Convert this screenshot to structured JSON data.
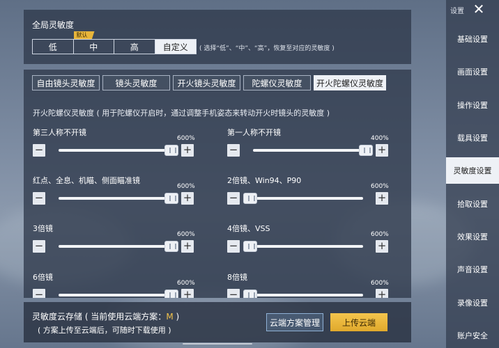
{
  "global": {
    "title": "全局灵敏度",
    "badge": "默认",
    "options": [
      "低",
      "中",
      "高",
      "自定义"
    ],
    "hint": "( 选择“低”、“中”、“高”，恢复至对应的灵敏度 )"
  },
  "tabs": [
    "自由镜头灵敏度",
    "镜头灵敏度",
    "开火镜头灵敏度",
    "陀螺仪灵敏度",
    "开火陀螺仪灵敏度"
  ],
  "section": {
    "description": "开火陀螺仪灵敏度 ( 用于陀螺仪开启时，通过调整手机姿态来转动开火时镜头的灵敏度 )"
  },
  "sliders": [
    {
      "label": "第三人称不开镜",
      "value_label": "600%",
      "value": 1.0
    },
    {
      "label": "第一人称不开镜",
      "value_label": "400%",
      "value": 1.0
    },
    {
      "label": "红点、全息、机瞄、侧面瞄准镜",
      "value_label": "600%",
      "value": 1.0
    },
    {
      "label": "2倍镜、Win94、P90",
      "value_label": "600%",
      "value": 0.0
    },
    {
      "label": "3倍镜",
      "value_label": "600%",
      "value": 1.0
    },
    {
      "label": "4倍镜、VSS",
      "value_label": "600%",
      "value": 0.0
    },
    {
      "label": "6倍镜",
      "value_label": "600%",
      "value": 1.0
    },
    {
      "label": "8倍镜",
      "value_label": "600%",
      "value": 0.0
    }
  ],
  "controls": {
    "minus": "−",
    "plus": "+"
  },
  "footer": {
    "line1_prefix": "灵敏度云存储 ( 当前使用云端方案：",
    "line1_value": "M",
    "line1_suffix": " )",
    "line2": "( 方案上传至云端后，可随时下载使用 )",
    "manage_button": "云端方案管理",
    "upload_button": "上传云端"
  },
  "sidebar": {
    "header": "设置",
    "close": "✕",
    "items": [
      "基础设置",
      "画面设置",
      "操作设置",
      "载具设置",
      "灵敏度设置",
      "拾取设置",
      "效果设置",
      "声音设置",
      "录像设置",
      "账户安全"
    ],
    "selected_index": 4
  },
  "colors": {
    "accent": "#f0c14b",
    "selected_bg": "#eef1f6",
    "upload_button": "#e8b23a"
  }
}
